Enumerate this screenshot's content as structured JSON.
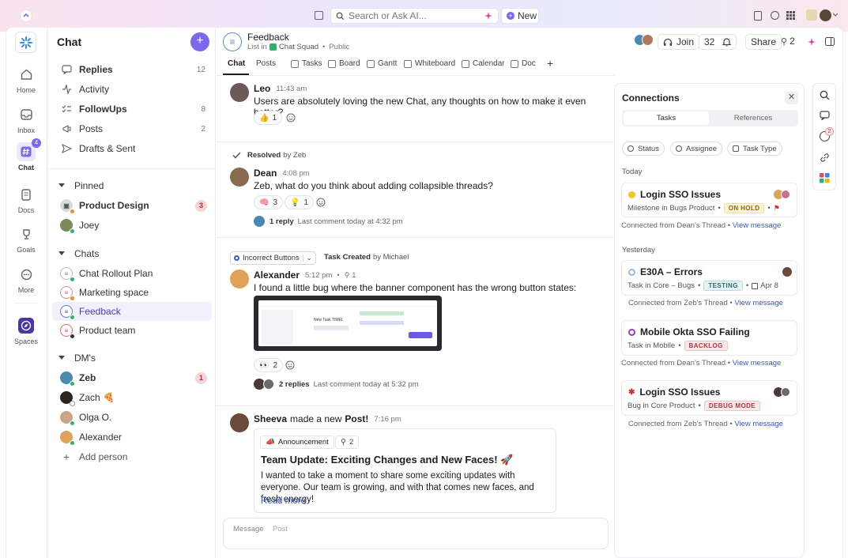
{
  "topbar": {
    "search_placeholder": "Search or Ask AI...",
    "new_label": "New"
  },
  "rail": {
    "home": "Home",
    "inbox": "Inbox",
    "chat": "Chat",
    "chat_badge": "4",
    "docs": "Docs",
    "goals": "Goals",
    "more": "More",
    "spaces": "Spaces"
  },
  "sidebar": {
    "title": "Chat",
    "top": [
      {
        "label": "Replies",
        "count": "12"
      },
      {
        "label": "Activity",
        "count": ""
      },
      {
        "label": "FollowUps",
        "count": "8"
      },
      {
        "label": "Posts",
        "count": "2"
      },
      {
        "label": "Drafts & Sent",
        "count": ""
      }
    ],
    "pinned_label": "Pinned",
    "pinned": [
      {
        "label": "Product Design",
        "badge": "3"
      },
      {
        "label": "Joey",
        "badge": ""
      }
    ],
    "chats_label": "Chats",
    "chats": [
      {
        "label": "Chat Rollout Plan"
      },
      {
        "label": "Marketing space"
      },
      {
        "label": "Feedback"
      },
      {
        "label": "Product team"
      }
    ],
    "dms_label": "DM's",
    "dms": [
      {
        "label": "Zeb",
        "badge": "1"
      },
      {
        "label": "Zach 🍕",
        "badge": ""
      },
      {
        "label": "Olga O.",
        "badge": ""
      },
      {
        "label": "Alexander",
        "badge": ""
      }
    ],
    "add_person": "Add person"
  },
  "header": {
    "title": "Feedback",
    "list_in": "List in",
    "space": "Chat Squad",
    "visibility": "Public",
    "join": "Join",
    "count": "32",
    "share": "Share",
    "share_count": "2"
  },
  "tabs": [
    "Chat",
    "Posts",
    "Tasks",
    "Board",
    "Gantt",
    "Whiteboard",
    "Calendar",
    "Doc"
  ],
  "messages": {
    "leo": {
      "name": "Leo",
      "time": "11:43 am",
      "text": "Users are absolutely loving the new Chat, any thoughts on how to make it even better?",
      "reaction": "👍",
      "reaction_count": "1"
    },
    "resolved": {
      "label": "Resolved",
      "by": "by Zeb"
    },
    "dean": {
      "name": "Dean",
      "time": "4:08 pm",
      "text": "Zeb, what do you think about adding collapsible threads?",
      "r1": "🧠",
      "r1_count": "3",
      "r2": "💡",
      "r2_count": "1",
      "replies": "1 reply",
      "last": "Last comment today at 4:32 pm"
    },
    "task": {
      "tag": "Incorrect Buttons",
      "created": "Task Created",
      "by": "by Michael"
    },
    "alexander": {
      "name": "Alexander",
      "time": "5:12 pm",
      "sub_count": "1",
      "text": "I found a little bug where the banner component has the wrong button states:",
      "shot_label": "New Task TIMEL",
      "r1": "👀",
      "r1_count": "2",
      "replies": "2 replies",
      "last": "Last comment today at 5:32 pm"
    },
    "sheeva": {
      "name": "Sheeva",
      "made": "made a new",
      "post": "Post!",
      "time": "7:16 pm",
      "badge": "Announcement",
      "sub_count": "2",
      "post_title": "Team Update: Exciting Changes and New Faces! 🚀",
      "body": "I wanted to take a moment to share some exciting updates with everyone. Our team is growing, and with that comes new faces, and fresh energy!",
      "read_more": "Read more"
    }
  },
  "composer": {
    "message": "Message",
    "post": "Post"
  },
  "connections": {
    "title": "Connections",
    "tab_tasks": "Tasks",
    "tab_refs": "References",
    "filters": [
      "Status",
      "Assignee",
      "Task Type"
    ],
    "today": "Today",
    "yesterday": "Yesterday",
    "cards": [
      {
        "title": "Login SSO Issues",
        "sub": "Milestone in Bugs Product",
        "status": "ON HOLD",
        "foot": "Connected from Dean's Thread",
        "link": "View message"
      },
      {
        "title": "E30A – Errors",
        "sub": "Task in Core – Bugs",
        "status": "TESTING",
        "date": "Apr 8",
        "foot": "Connected from Zeb's Thread",
        "link": "View message"
      },
      {
        "title": "Mobile Okta SSO Failing",
        "sub": "Task in Mobile",
        "status": "BACKLOG",
        "foot": "Connected from Dean's Thread",
        "link": "View message"
      },
      {
        "title": "Login SSO Issues",
        "sub": "Bug in Core Product",
        "status": "DEBUG MODE",
        "foot": "Connected from Zeb's Thread",
        "link": "View message"
      }
    ]
  },
  "rightbar": {
    "badge": "2"
  },
  "colors": {
    "accent": "#7b68ee",
    "link": "#3b57d0",
    "badge_red": "#c0262d"
  }
}
